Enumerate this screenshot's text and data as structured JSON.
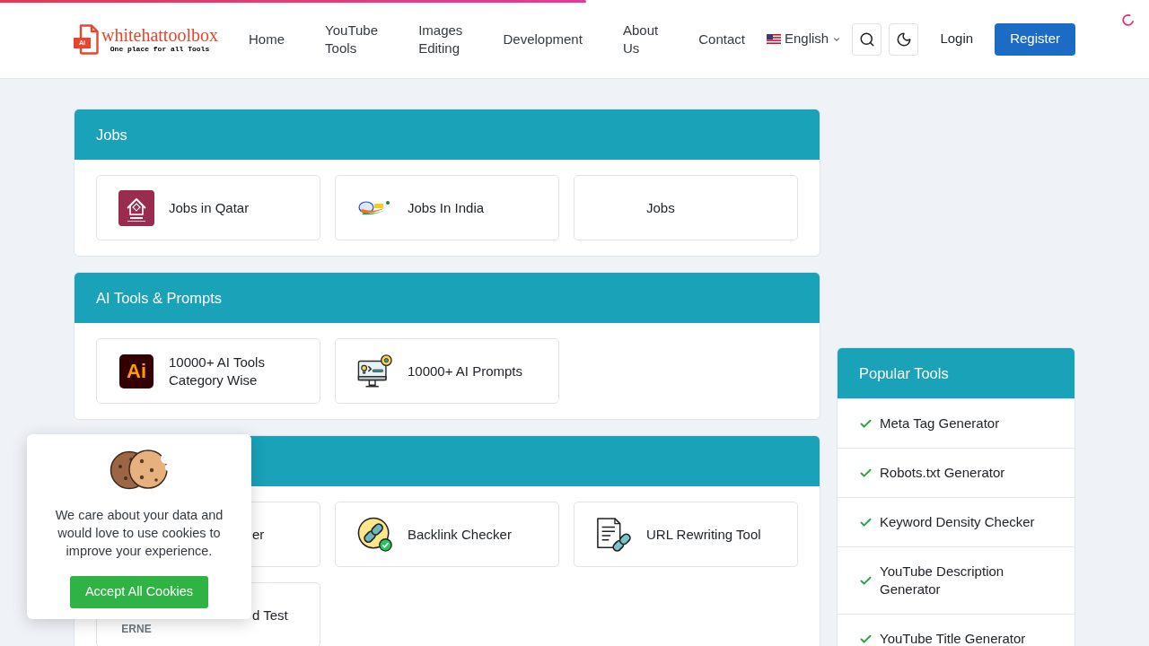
{
  "loading_bar": {
    "level": 0.51
  },
  "header": {
    "logo": {
      "badge": "AI",
      "name": "whitehattoolbox",
      "tagline": "One place for all Tools"
    },
    "nav": [
      {
        "label": "Home"
      },
      {
        "label": "YouTube Tools"
      },
      {
        "label": "Images Editing"
      },
      {
        "label": "Development"
      },
      {
        "label": "About Us"
      },
      {
        "label": "Contact"
      }
    ],
    "language": "English",
    "login": "Login",
    "register": "Register"
  },
  "sections": [
    {
      "title": "Jobs",
      "cards": [
        {
          "kind": "full",
          "label": "Jobs in Qatar"
        },
        {
          "kind": "full",
          "label": "Jobs In India"
        },
        {
          "kind": "full",
          "label": "Jobs"
        }
      ]
    },
    {
      "title": "AI Tools & Prompts",
      "cards": [
        {
          "kind": "full",
          "logo_text": "Ai",
          "label": "10000+ AI Tools Category Wise"
        },
        {
          "kind": "full",
          "label": "10000+ AI Prompts"
        }
      ]
    },
    {
      "cards": [
        {
          "kind": "covered",
          "label": "er"
        },
        {
          "kind": "full",
          "label": "Backlink Checker"
        },
        {
          "kind": "full",
          "label": "URL Rewriting Tool"
        },
        {
          "kind": "covered",
          "logo_text": "ERNE",
          "label": "d Test"
        }
      ]
    }
  ],
  "cookie_notice": {
    "message": "We care about your data and would love to use cookies to improve your experience.",
    "button": "Accept All Cookies"
  },
  "popular_tools": {
    "title": "Popular Tools",
    "items": [
      "Meta Tag Generator",
      "Robots.txt Generator",
      "Keyword Density Checker",
      "YouTube Description Generator",
      "YouTube Title Generator"
    ]
  }
}
